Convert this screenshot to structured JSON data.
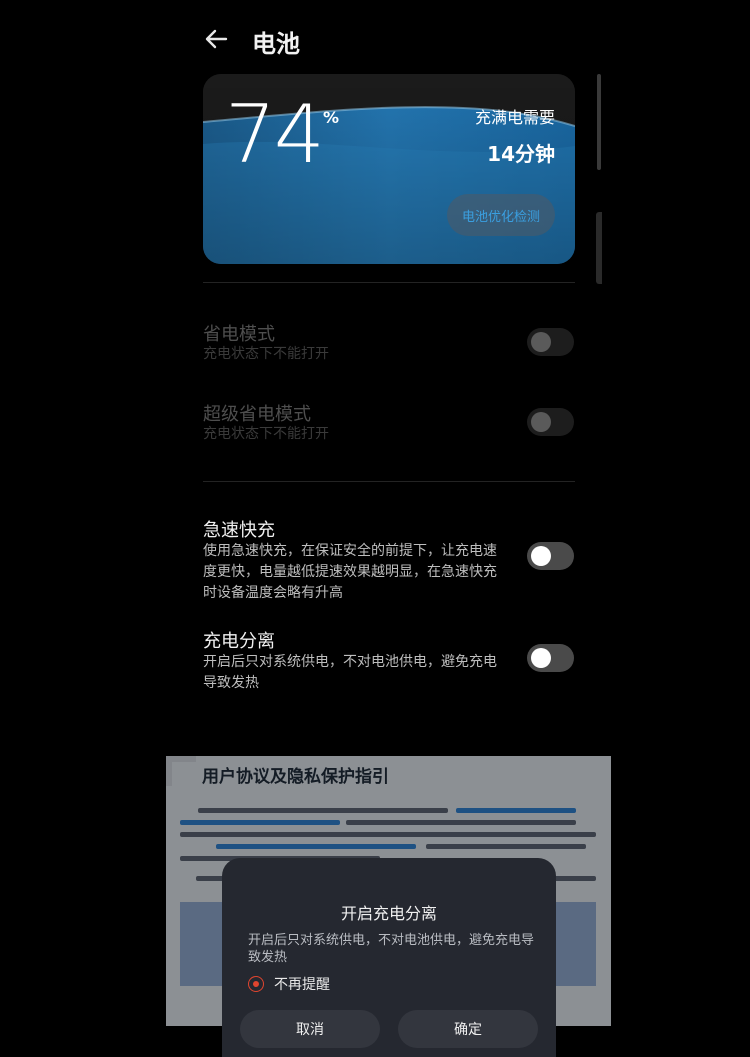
{
  "header": {
    "title": "电池"
  },
  "battery_card": {
    "percent": "74",
    "percent_sign": "%",
    "full_label": "充满电需要",
    "full_time": "14分钟",
    "detect_button": "电池优化检测",
    "charge_level": 0.74
  },
  "settings": [
    {
      "title": "省电模式",
      "subtitle": "充电状态下不能打开",
      "enabled": false,
      "on": false
    },
    {
      "title": "超级省电模式",
      "subtitle": "充电状态下不能打开",
      "enabled": false,
      "on": false
    },
    {
      "title": "急速快充",
      "subtitle": "使用急速快充，在保证安全的前提下，让充电速度更快，电量越低提速效果越明显，在急速快充时设备温度会略有升高",
      "enabled": true,
      "on": false
    },
    {
      "title": "充电分离",
      "subtitle": "开启后只对系统供电，不对电池供电，避免充电导致发热",
      "enabled": true,
      "on": false
    }
  ],
  "background_card": {
    "title": "用户协议及隐私保护指引"
  },
  "dialog": {
    "title": "开启充电分离",
    "message": "开启后只对系统供电，不对电池供电，避免充电导致发热",
    "checkbox_label": "不再提醒",
    "cancel": "取消",
    "confirm": "确定"
  },
  "colors": {
    "accent_red": "#e0452f",
    "link_blue": "#3a9fe0",
    "card_blue": "#1e6ea8"
  }
}
